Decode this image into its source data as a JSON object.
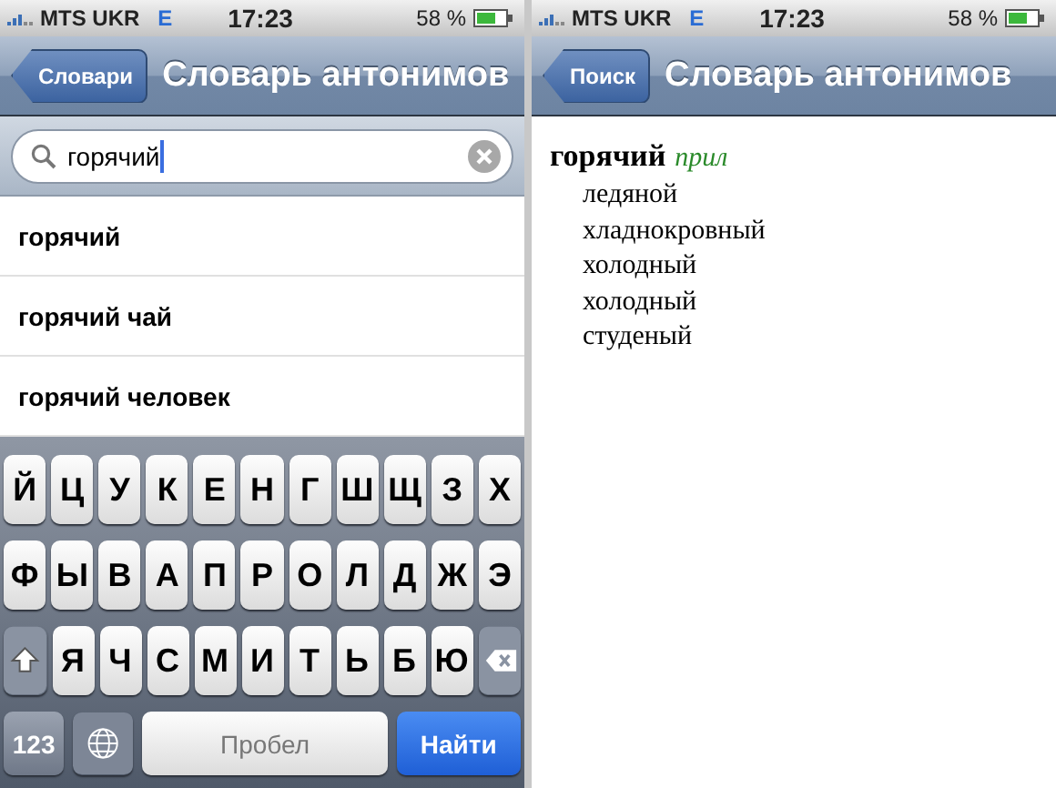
{
  "search_screen": {
    "status_bar": {
      "carrier": "MTS UKR",
      "network": "E",
      "time": "17:23",
      "battery": "58 %"
    },
    "nav_bar": {
      "back": "Словари",
      "title": "Словарь антонимов"
    },
    "search": {
      "value": "горячий"
    },
    "results": [
      "горячий",
      "горячий чай",
      "горячий человек"
    ],
    "keyboard": {
      "top_row": {
        "keys": [
          "Й",
          "Ц",
          "У",
          "К",
          "Е",
          "Н",
          "Г",
          "Ш",
          "Щ",
          "З",
          "Х"
        ]
      },
      "middle_row": {
        "keys": [
          "Ф",
          "Ы",
          "В",
          "А",
          "П",
          "Р",
          "О",
          "Л",
          "Д",
          "Ж",
          "Э"
        ]
      },
      "bottom_row": {
        "keys": [
          "Я",
          "Ч",
          "С",
          "М",
          "И",
          "Т",
          "Ь",
          "Б",
          "Ю"
        ]
      },
      "numbers": "123",
      "space": "Пробел",
      "go": "Найти"
    }
  },
  "entry_screen": {
    "status_bar": {
      "carrier": "MTS UKR",
      "network": "E",
      "time": "17:23",
      "battery": "58 %"
    },
    "nav_bar": {
      "back": "Поиск",
      "title": "Словарь антонимов"
    },
    "headword": "горячий",
    "part_of_speech": "прил",
    "antonyms": [
      "ледяной",
      "хладнокровный",
      "холодный",
      "холодный",
      "студеный"
    ]
  }
}
